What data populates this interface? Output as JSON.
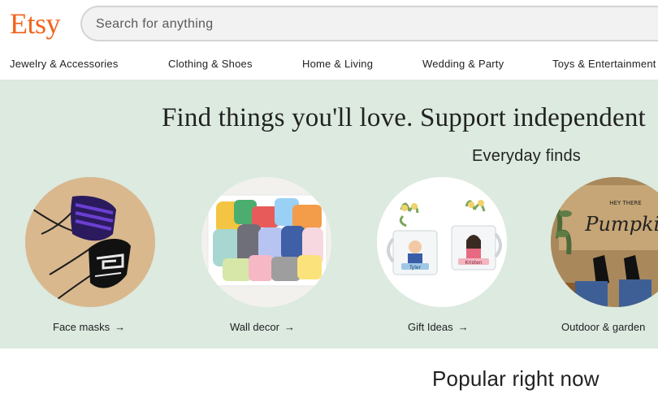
{
  "brand": {
    "logo_text": "Etsy",
    "accent_color": "#f1641e"
  },
  "search": {
    "placeholder": "Search for anything"
  },
  "nav": {
    "items": [
      {
        "label": "Jewelry & Accessories"
      },
      {
        "label": "Clothing & Shoes"
      },
      {
        "label": "Home & Living"
      },
      {
        "label": "Wedding & Party"
      },
      {
        "label": "Toys & Entertainment"
      }
    ]
  },
  "hero": {
    "tagline": "Find things you'll love. Support independent",
    "section_title": "Everyday finds",
    "background_color": "#dceae0",
    "categories": [
      {
        "label": "Face masks",
        "icon": "arrow-right-icon"
      },
      {
        "label": "Wall decor",
        "icon": "arrow-right-icon"
      },
      {
        "label": "Gift Ideas",
        "icon": "arrow-right-icon"
      },
      {
        "label": "Outdoor & garden"
      }
    ],
    "mug_names": [
      "Tyler",
      "Kristen"
    ],
    "doormat_text": {
      "small": "HEY THERE",
      "large": "Pumpkin"
    }
  },
  "popular": {
    "title": "Popular right now"
  }
}
